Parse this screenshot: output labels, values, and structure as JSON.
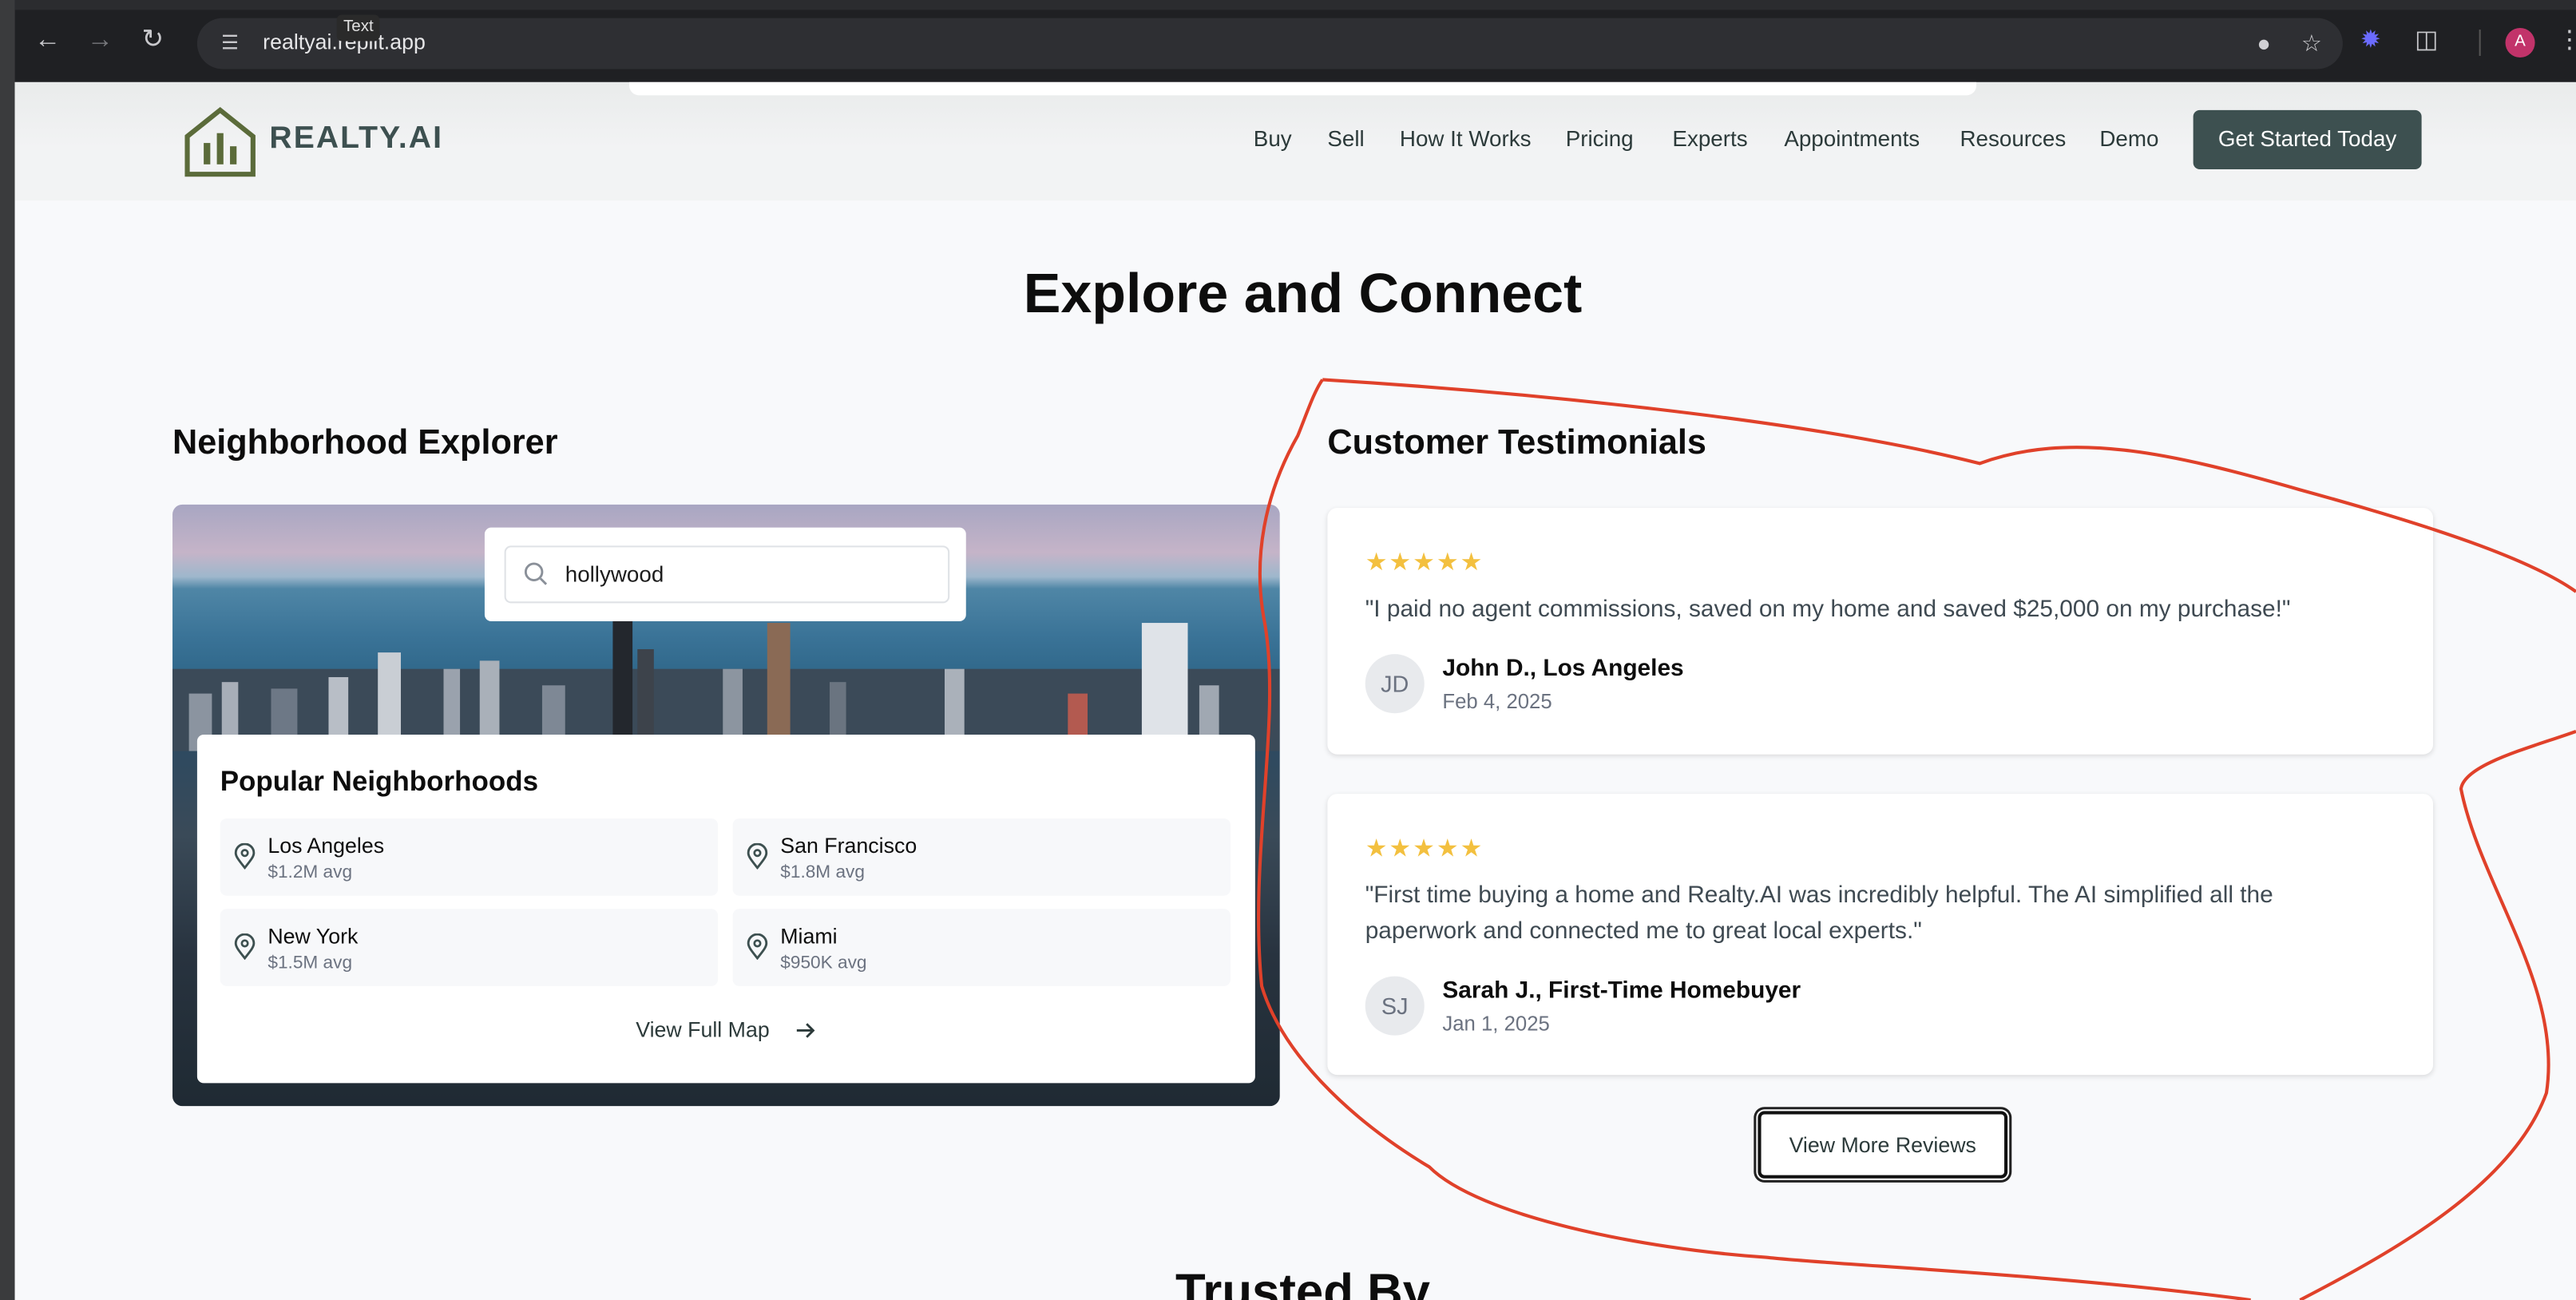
{
  "browser": {
    "url": "realtyai.replit.app",
    "tooltip": "Text",
    "profile_initial": "A"
  },
  "header": {
    "brand": "REALTY.AI",
    "nav": [
      "Buy",
      "Sell",
      "How It Works",
      "Pricing",
      "Experts",
      "Appointments",
      "Resources",
      "Demo"
    ],
    "cta_label": "Get Started Today"
  },
  "section": {
    "title": "Explore and Connect"
  },
  "explorer": {
    "title": "Neighborhood Explorer",
    "search_value": "hollywood",
    "popular_title": "Popular Neighborhoods",
    "neighborhoods": [
      {
        "name": "Los Angeles",
        "avg": "$1.2M avg"
      },
      {
        "name": "San Francisco",
        "avg": "$1.8M avg"
      },
      {
        "name": "New York",
        "avg": "$1.5M avg"
      },
      {
        "name": "Miami",
        "avg": "$950K avg"
      }
    ],
    "view_map_label": "View Full Map"
  },
  "testimonials": {
    "title": "Customer Testimonials",
    "items": [
      {
        "stars": "★★★★★",
        "quote": "\"I paid no agent commissions, saved on my home and saved $25,000 on my purchase!\"",
        "initials": "JD",
        "name": "John D., Los Angeles",
        "date": "Feb 4, 2025"
      },
      {
        "stars": "★★★★★",
        "quote": "\"First time buying a home and Realty.AI was incredibly helpful. The AI simplified all the paperwork and connected me to great local experts.\"",
        "initials": "SJ",
        "name": "Sarah J., First-Time Homebuyer",
        "date": "Jan 1, 2025"
      }
    ],
    "more_label": "View More Reviews"
  },
  "next_section": {
    "title": "Trusted By"
  },
  "colors": {
    "brand": "#3d5050",
    "star": "#f3c03f",
    "annotation": "#e0412a"
  }
}
